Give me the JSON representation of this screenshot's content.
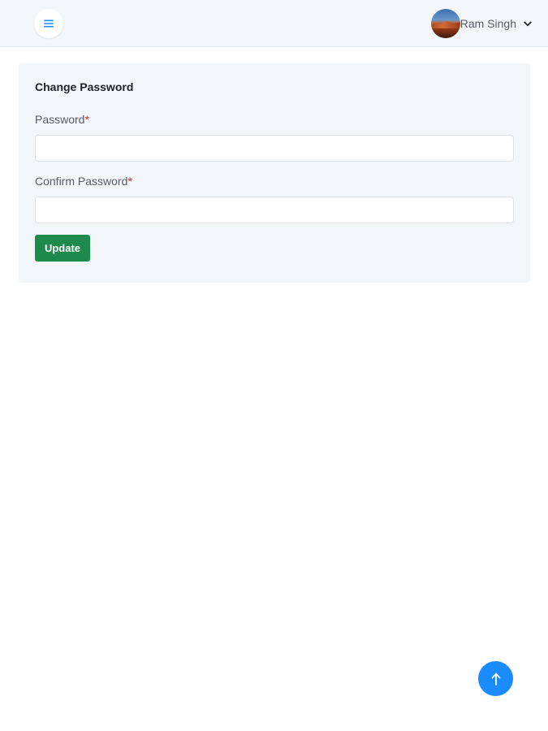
{
  "header": {
    "menu_icon": "hamburger-menu-icon",
    "user": {
      "name": "Ram Singh",
      "avatar_icon": "user-avatar",
      "dropdown_icon": "chevron-down-icon"
    }
  },
  "change_password": {
    "title": "Change Password",
    "password": {
      "label": "Password",
      "required_mark": "*",
      "value": "",
      "placeholder": ""
    },
    "confirm_password": {
      "label": "Confirm Password",
      "required_mark": "*",
      "value": "",
      "placeholder": ""
    },
    "submit_label": "Update"
  },
  "scroll_top": {
    "icon": "arrow-up-icon"
  },
  "colors": {
    "header_bg": "#f3f6f9",
    "card_bg": "#f3f6f9",
    "menu_icon": "#1a8cff",
    "required_mark": "#e02424",
    "update_button": "#1e8a4c",
    "scroll_top_button": "#1a8cff"
  }
}
